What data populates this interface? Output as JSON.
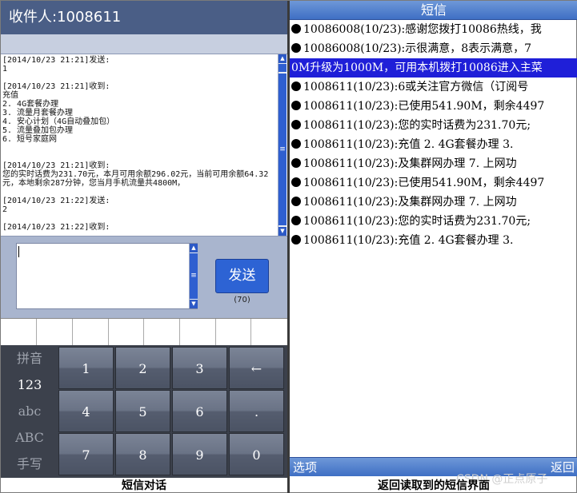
{
  "left": {
    "recipient_label": "收件人:1008611",
    "conversation": "[2014/10/23 21:21]发送:\n1\n\n[2014/10/23 21:21]收到:\n充值\n2. 4G套餐办理\n3. 流量月套餐办理\n4. 安心计划（4G自动叠加包）\n5. 流量叠加包办理\n6. 短号家庭网\n\n\n[2014/10/23 21:21]收到:\n您的实时话费为231.70元，本月可用余额296.02元，当前可用余额64.32元，本地剩余287分钟，您当月手机流量共4800M，\n\n[2014/10/23 21:22]发送:\n2\n\n[2014/10/23 21:22]收到:",
    "send_label": "发送",
    "char_count": "(70)",
    "input_modes": [
      {
        "label": "拼音",
        "active": false
      },
      {
        "label": "123",
        "active": true
      },
      {
        "label": "abc",
        "active": false
      },
      {
        "label": "ABC",
        "active": false
      },
      {
        "label": "手写",
        "active": false
      }
    ],
    "keys": [
      "1",
      "2",
      "3",
      "←",
      "4",
      "5",
      "6",
      ".",
      "7",
      "8",
      "9",
      "0"
    ],
    "caption": "短信对话"
  },
  "right": {
    "title": "短信",
    "messages": [
      {
        "text": "10086008(10/23):感谢您拨打10086热线，我",
        "bullet": true,
        "selected": false
      },
      {
        "text": "10086008(10/23):示很满意，8表示满意，7",
        "bullet": true,
        "selected": false
      },
      {
        "text": "0M升级为1000M，可用本机拨打10086进入主菜",
        "bullet": false,
        "selected": true
      },
      {
        "text": "1008611(10/23):6或关注官方微信（订阅号",
        "bullet": true,
        "selected": false
      },
      {
        "text": "1008611(10/23):已使用541.90M，剩余4497",
        "bullet": true,
        "selected": false
      },
      {
        "text": "1008611(10/23):您的实时话费为231.70元;",
        "bullet": true,
        "selected": false
      },
      {
        "text": "1008611(10/23):充值  2. 4G套餐办理  3.",
        "bullet": true,
        "selected": false
      },
      {
        "text": "1008611(10/23):及集群网办理  7. 上网功",
        "bullet": true,
        "selected": false
      },
      {
        "text": "1008611(10/23):已使用541.90M，剩余4497",
        "bullet": true,
        "selected": false
      },
      {
        "text": "1008611(10/23):及集群网办理  7. 上网功",
        "bullet": true,
        "selected": false
      },
      {
        "text": "1008611(10/23):您的实时话费为231.70元;",
        "bullet": true,
        "selected": false
      },
      {
        "text": "1008611(10/23):充值  2. 4G套餐办理  3.",
        "bullet": true,
        "selected": false
      }
    ],
    "footer_left": "选项",
    "footer_right": "返回",
    "watermark": "CSDN @正点原子",
    "caption": "返回读取到的短信界面"
  }
}
